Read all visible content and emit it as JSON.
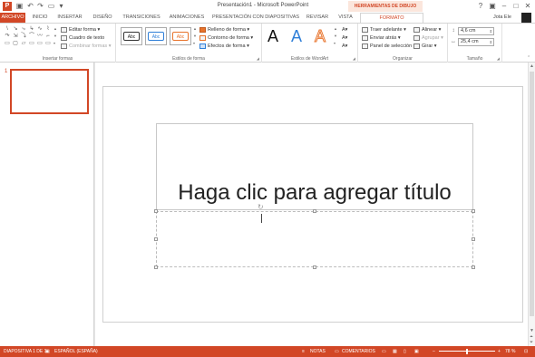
{
  "titlebar": {
    "window_title": "Presentación1 - Microsoft PowerPoint",
    "context_label": "HERRAMIENTAS DE DIBUJO",
    "app_logo": "P",
    "quick_access": [
      "save-icon",
      "undo-icon",
      "redo-icon",
      "start-presentation-icon",
      "customize-icon"
    ]
  },
  "tabs": [
    {
      "label": "ARCHIVO"
    },
    {
      "label": "INICIO"
    },
    {
      "label": "INSERTAR"
    },
    {
      "label": "DISEÑO"
    },
    {
      "label": "TRANSICIONES"
    },
    {
      "label": "ANIMACIONES"
    },
    {
      "label": "PRESENTACIÓN CON DIAPOSITIVAS"
    },
    {
      "label": "REVISAR"
    },
    {
      "label": "VISTA"
    },
    {
      "label": "FORMATO"
    }
  ],
  "user": {
    "name": "Jota Ele"
  },
  "ribbon": {
    "insert_shapes": {
      "label": "Insertar formas",
      "edit_shape": "Editar forma",
      "text_box": "Cuadro de texto",
      "merge_shapes": "Combinar formas"
    },
    "shape_styles": {
      "label": "Estilos de forma",
      "samples": [
        "Abc",
        "Abc",
        "Abc"
      ],
      "fill": "Relleno de forma",
      "outline": "Contorno de forma",
      "effects": "Efectos de forma"
    },
    "wordart": {
      "label": "Estilos de WordArt",
      "letters": [
        "A",
        "A",
        "A"
      ]
    },
    "arrange": {
      "label": "Organizar",
      "bring_forward": "Traer adelante",
      "send_backward": "Enviar atrás",
      "selection_pane": "Panel de selección",
      "align": "Alinear",
      "group": "Agrupar",
      "rotate": "Girar"
    },
    "size": {
      "label": "Tamaño",
      "height": "4,6 cm",
      "width": "25,4 cm"
    }
  },
  "thumbnails": [
    {
      "number": "1"
    }
  ],
  "slide": {
    "title_placeholder": "Haga clic para agregar título"
  },
  "statusbar": {
    "slide_info": "DIAPOSITIVA 1 DE 1",
    "language": "ESPAÑOL (ESPAÑA)",
    "notes": "NOTAS",
    "comments": "COMENTARIOS",
    "zoom": "78 %"
  },
  "colors": {
    "accent": "#d24726",
    "wordart_black": "#111111",
    "wordart_blue": "#2f7fd8",
    "wordart_orange": "#e8732b"
  }
}
